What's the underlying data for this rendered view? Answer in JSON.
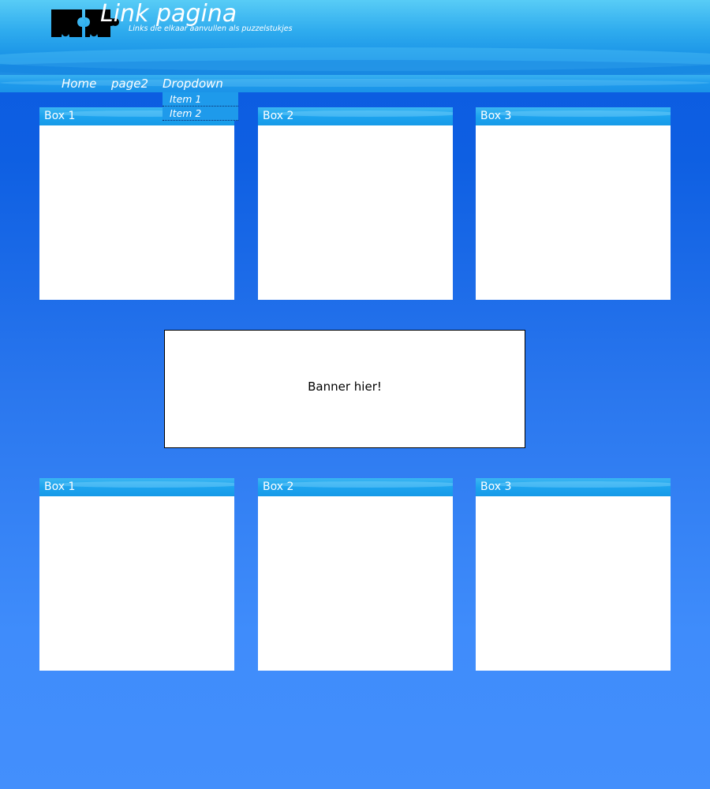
{
  "header": {
    "title": "Link pagina",
    "subtitle": "Links  die elkaar aanvullen als puzzelstukjes",
    "logo_icon": "puzzle-pieces-icon"
  },
  "nav": {
    "items": [
      {
        "label": "Home"
      },
      {
        "label": "page2"
      },
      {
        "label": "Dropdown"
      }
    ],
    "dropdown": {
      "items": [
        {
          "label": "Item 1"
        },
        {
          "label": "Item 2"
        }
      ]
    }
  },
  "boxes_top": [
    {
      "title": "Box 1"
    },
    {
      "title": "Box 2"
    },
    {
      "title": "Box 3"
    }
  ],
  "banner": {
    "text": "Banner hier!"
  },
  "boxes_bottom": [
    {
      "title": "Box 1"
    },
    {
      "title": "Box 2"
    },
    {
      "title": "Box 3"
    }
  ],
  "colors": {
    "background": "#2a77ee",
    "header": "#1d8de4",
    "box_header": "#1da3ee",
    "box_body": "#ffffff"
  }
}
